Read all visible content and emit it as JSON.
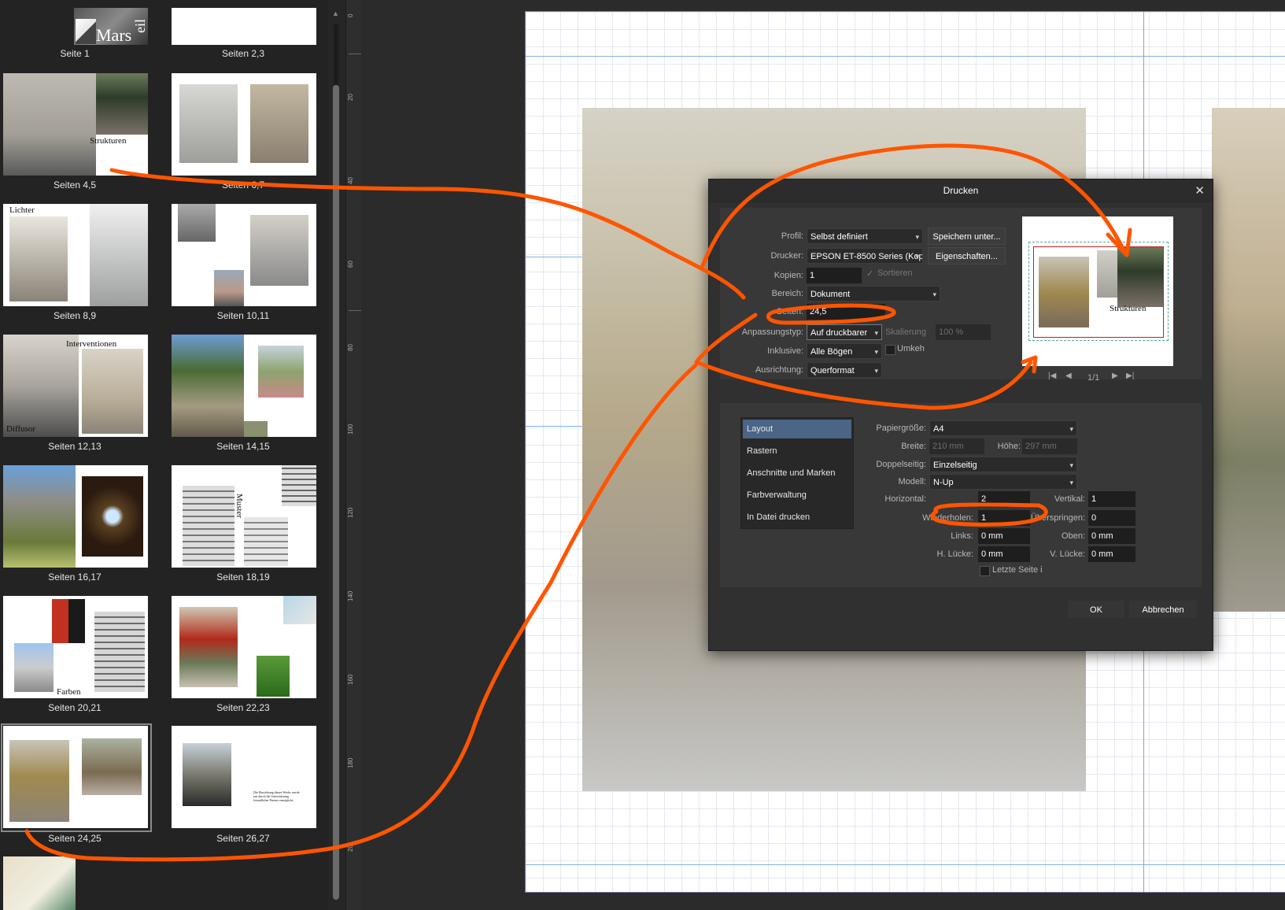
{
  "pages_panel": {
    "thumbnails": [
      {
        "label": "Seite 1",
        "title": "Mars",
        "title2": "eil"
      },
      {
        "label": "Seiten 2,3"
      },
      {
        "label": "Seiten 4,5",
        "title": "Strukturen"
      },
      {
        "label": "Seiten 6,7"
      },
      {
        "label": "Seiten 8,9",
        "title": "Lichter"
      },
      {
        "label": "Seiten 10,11"
      },
      {
        "label": "Seiten 12,13",
        "title": "Interventionen",
        "title2": "Diffusor"
      },
      {
        "label": "Seiten 14,15"
      },
      {
        "label": "Seiten 16,17"
      },
      {
        "label": "Seiten 18,19",
        "title": "Muster"
      },
      {
        "label": "Seiten 20,21",
        "title": "Farben"
      },
      {
        "label": "Seiten 22,23"
      },
      {
        "label": "Seiten 24,25"
      },
      {
        "label": "Seiten 26,27"
      }
    ]
  },
  "ruler": {
    "marks": [
      "0",
      "20",
      "40",
      "60",
      "80",
      "100",
      "120",
      "140",
      "160",
      "180",
      "20"
    ]
  },
  "dialog": {
    "title": "Drucken",
    "close_icon": "close-icon",
    "profil_label": "Profil:",
    "profil_value": "Selbst definiert",
    "save_as_button": "Speichern unter...",
    "drucker_label": "Drucker:",
    "drucker_value": "EPSON ET-8500 Series (Kop",
    "properties_button": "Eigenschaften...",
    "kopien_label": "Kopien:",
    "kopien_value": "1",
    "sortieren_label": "Sortieren",
    "bereich_label": "Bereich:",
    "bereich_value": "Dokument",
    "seiten_label": "Seiten:",
    "seiten_value": "24,5",
    "anpassung_label": "Anpassungstyp:",
    "anpassung_value": "Auf druckbarer",
    "skalierung_label": "Skalierung",
    "skalierung_value": "100 %",
    "inklusive_label": "Inklusive:",
    "inklusive_value": "Alle Bögen",
    "umkehren_label": "Umkeh",
    "ausrichtung_label": "Ausrichtung:",
    "ausrichtung_value": "Querformat",
    "preview_title": "Strukturen",
    "page_indicator": "1/1",
    "sidebar_items": [
      "Layout",
      "Rastern",
      "Anschnitte und Marken",
      "Farbverwaltung",
      "In Datei drucken"
    ],
    "papiergroesse_label": "Papiergröße:",
    "papiergroesse_value": "A4",
    "breite_label": "Breite:",
    "breite_value": "210 mm",
    "hoehe_label": "Höhe:",
    "hoehe_value": "297 mm",
    "doppelseitig_label": "Doppelseitig:",
    "doppelseitig_value": "Einzelseitig",
    "modell_label": "Modell:",
    "modell_value": "N-Up",
    "horizontal_label": "Horizontal:",
    "horizontal_value": "2",
    "vertikal_label": "Vertikal:",
    "vertikal_value": "1",
    "wiederholen_label": "Wiederholen:",
    "wiederholen_value": "1",
    "ueberspringen_label": "Überspringen:",
    "ueberspringen_value": "0",
    "links_label": "Links:",
    "links_value": "0 mm",
    "oben_label": "Oben:",
    "oben_value": "0 mm",
    "hluecke_label": "H. Lücke:",
    "hluecke_value": "0 mm",
    "vluecke_label": "V. Lücke:",
    "vluecke_value": "0 mm",
    "letzte_seite_label": "Letzte Seite i",
    "ok_button": "OK",
    "cancel_button": "Abbrechen"
  },
  "page_26_text": "Die Einrichtung dieses Werks wurde nur durch die Unterstützung freundlicher Partner ermöglicht.",
  "colors": {
    "accent": "#4a6585",
    "annotation": "#ff5500",
    "guide": "#7fb2e0"
  }
}
